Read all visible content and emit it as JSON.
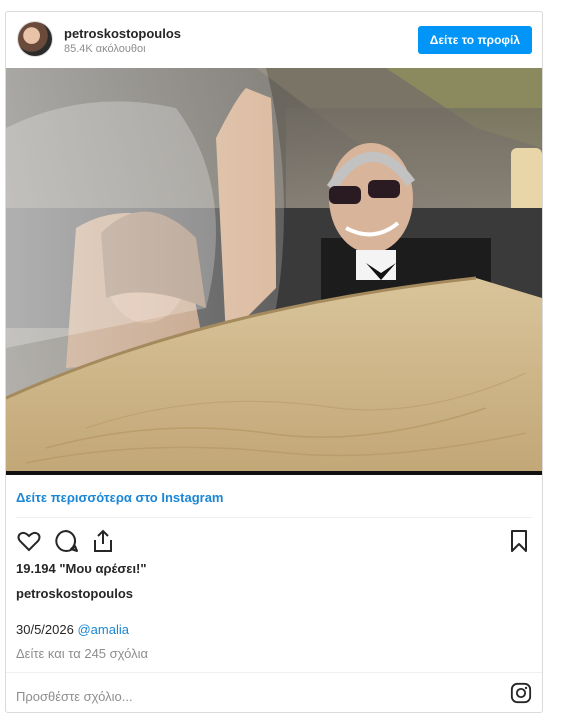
{
  "post": {
    "username": "petroskostopoulos",
    "followers": "85.4K ακόλουθοι",
    "profile_button": "Δείτε το προφίλ",
    "see_more": "Δείτε περισσότερα στο Instagram",
    "likes": "19.194 \"Μου αρέσει!\"",
    "caption_user": "petroskostopoulos",
    "date": "30/5/2026",
    "mention": "@amalia",
    "view_comments": "Δείτε και τα 245 σχόλια",
    "add_comment_placeholder": "Προσθέστε σχόλιο..."
  },
  "icons": {
    "like": "heart-icon",
    "comment": "comment-icon",
    "share": "share-icon",
    "save": "bookmark-icon",
    "instagram": "instagram-icon"
  },
  "colors": {
    "accent": "#0095f6",
    "link": "#1a87d6",
    "muted": "#8e8e8e"
  }
}
